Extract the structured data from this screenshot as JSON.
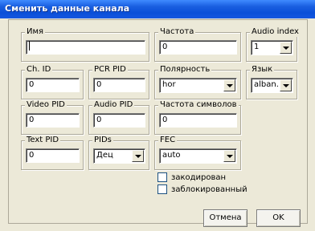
{
  "window": {
    "title": "Сменить данные канала"
  },
  "fields": {
    "name": {
      "label": "Имя",
      "value": ""
    },
    "frequency": {
      "label": "Частота",
      "value": "0"
    },
    "audio_index": {
      "label": "Audio index",
      "value": "1"
    },
    "ch_id": {
      "label": "Ch. ID",
      "value": "0"
    },
    "pcr_pid": {
      "label": "PCR PID",
      "value": "0"
    },
    "polarity": {
      "label": "Полярность",
      "value": "hor"
    },
    "language": {
      "label": "Язык",
      "value": "alban."
    },
    "video_pid": {
      "label": "Video PID",
      "value": "0"
    },
    "audio_pid": {
      "label": "Audio PID",
      "value": "0"
    },
    "symbol_rate": {
      "label": "Частота символов",
      "value": "0"
    },
    "text_pid": {
      "label": "Text PID",
      "value": "0"
    },
    "pids": {
      "label": "PIDs",
      "value": "Дец"
    },
    "fec": {
      "label": "FEC",
      "value": "auto"
    }
  },
  "checkboxes": {
    "encoded": {
      "label": "закодирован",
      "checked": false
    },
    "locked": {
      "label": "заблокированный",
      "checked": false
    }
  },
  "buttons": {
    "cancel": "Отмена",
    "ok": "OK"
  }
}
